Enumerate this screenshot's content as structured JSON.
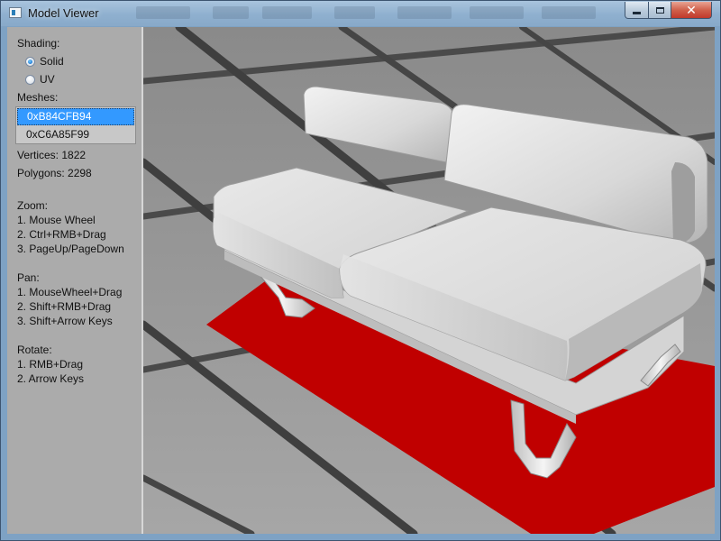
{
  "window": {
    "title": "Model Viewer",
    "controls": {
      "minimize": "minimize",
      "maximize": "maximize",
      "close": "✕"
    }
  },
  "sidebar": {
    "shading_label": "Shading:",
    "shading_options": [
      {
        "label": "Solid",
        "checked": true
      },
      {
        "label": "UV",
        "checked": false
      }
    ],
    "meshes_label": "Meshes:",
    "meshes": [
      {
        "label": "0xB84CFB94",
        "selected": true
      },
      {
        "label": "0xC6A85F99",
        "selected": false
      }
    ],
    "vertices": "Vertices: 1822",
    "polygons": "Polygons: 2298",
    "help": {
      "zoom": [
        "Zoom:",
        "1. Mouse Wheel",
        "2. Ctrl+RMB+Drag",
        "3. PageUp/PageDown"
      ],
      "pan": [
        "Pan:",
        "1. MouseWheel+Drag",
        "2. Shift+RMB+Drag",
        "3. Shift+Arrow Keys"
      ],
      "rotate": [
        "Rotate:",
        "1. RMB+Drag",
        "2. Arrow Keys"
      ]
    }
  },
  "viewport": {
    "model": "sofa",
    "colors": {
      "floor_plane": "#c00000",
      "model": "#e6e6e6",
      "grid_dark": "#3f3f3f",
      "grid_light": "#8c8c8c"
    }
  }
}
